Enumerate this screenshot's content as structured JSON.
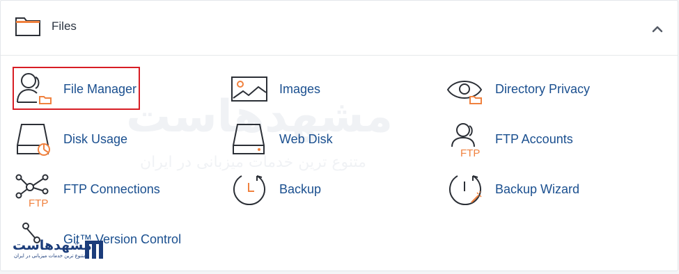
{
  "section": {
    "title": "Files"
  },
  "items": [
    {
      "label": "File Manager"
    },
    {
      "label": "Images"
    },
    {
      "label": "Directory Privacy"
    },
    {
      "label": "Disk Usage"
    },
    {
      "label": "Web Disk"
    },
    {
      "label": "FTP Accounts"
    },
    {
      "label": "FTP Connections"
    },
    {
      "label": "Backup"
    },
    {
      "label": "Backup Wizard"
    },
    {
      "label": "Git™ Version Control"
    }
  ],
  "icon_text": {
    "ftp": "FTP"
  },
  "watermark": {
    "main": "مشهدهاست",
    "sub": "متنوع ترین خدمات میزبانی در ایران"
  },
  "logo": {
    "main": "مشهدهاست",
    "sub": "متنوع ترین خدمات میزبانی در ایران"
  },
  "colors": {
    "link": "#1a4f8f",
    "icon_stroke": "#2b2f36",
    "icon_accent": "#f0813e",
    "highlight": "#d71d24"
  },
  "icons": {
    "header": "folder-icon",
    "collapse": "chevron-up-icon"
  }
}
